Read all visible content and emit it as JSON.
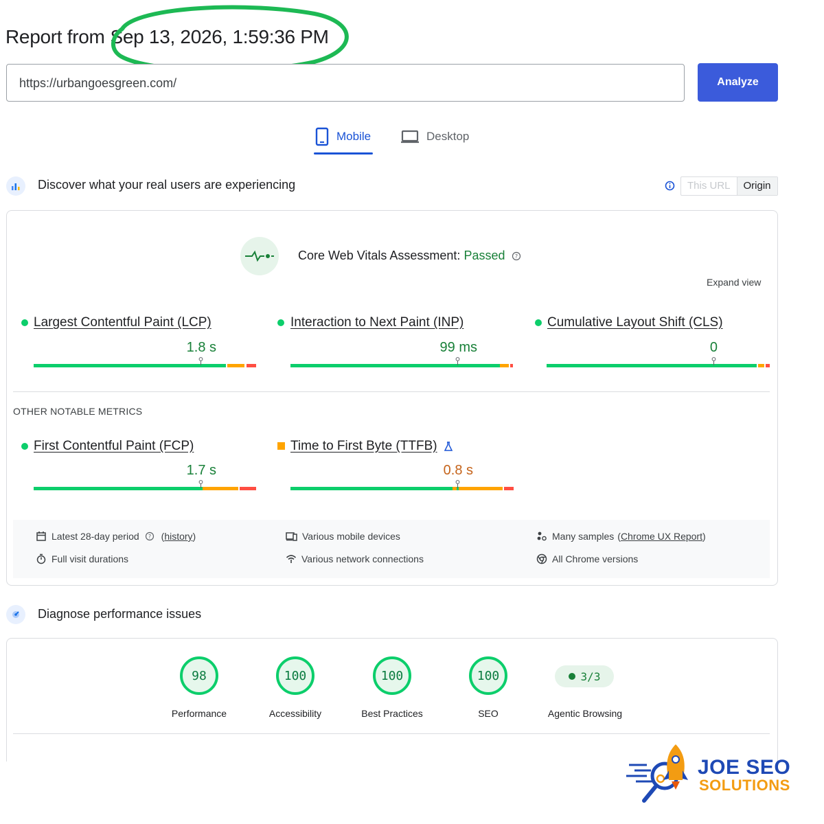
{
  "header": {
    "report_prefix": "Report from",
    "report_date": "Sep 13, 2026, 1:59:36 PM"
  },
  "url_input": {
    "value": "https://urbangoesgreen.com/"
  },
  "analyze_button": {
    "label": "Analyze",
    "color": "#3b5bdb"
  },
  "tabs": [
    {
      "label": "Mobile",
      "active": true
    },
    {
      "label": "Desktop",
      "active": false
    }
  ],
  "field_section": {
    "heading": "Discover what your real users are experiencing",
    "toggle": {
      "url_label": "This URL",
      "origin_label": "Origin",
      "selected": "Origin"
    }
  },
  "cwv": {
    "assessment_label": "Core Web Vitals Assessment:",
    "assessment_status": "Passed",
    "expand_label": "Expand view",
    "metrics": [
      {
        "name": "Largest Contentful Paint (LCP)",
        "value": "1.8 s",
        "status": "good",
        "distribution": [
          0.86,
          0.08,
          0.06
        ],
        "percentile_position": 0.75
      },
      {
        "name": "Interaction to Next Paint (INP)",
        "value": "99 ms",
        "status": "good",
        "distribution": [
          0.94,
          0.04,
          0.02
        ],
        "percentile_position": 0.75
      },
      {
        "name": "Cumulative Layout Shift (CLS)",
        "value": "0",
        "status": "good",
        "distribution": [
          0.94,
          0.04,
          0.02
        ],
        "percentile_position": 0.75
      }
    ]
  },
  "other_metrics": {
    "title": "OTHER NOTABLE METRICS",
    "metrics": [
      {
        "name": "First Contentful Paint (FCP)",
        "value": "1.7 s",
        "status": "good",
        "distribution": [
          0.76,
          0.16,
          0.08
        ],
        "percentile_position": 0.75
      },
      {
        "name": "Time to First Byte (TTFB)",
        "value": "0.8 s",
        "status": "needs-improvement",
        "distribution": [
          0.73,
          0.22,
          0.05
        ],
        "percentile_position": 0.75
      }
    ]
  },
  "footer_info": {
    "period": "Latest 28-day period",
    "history_link": "history",
    "devices": "Various mobile devices",
    "samples_prefix": "Many samples",
    "samples_link": "Chrome UX Report",
    "durations": "Full visit durations",
    "network": "Various network connections",
    "versions": "All Chrome versions"
  },
  "diagnose": {
    "heading": "Diagnose performance issues",
    "scores": [
      {
        "label": "Performance",
        "score": "98"
      },
      {
        "label": "Accessibility",
        "score": "100"
      },
      {
        "label": "Best Practices",
        "score": "100"
      },
      {
        "label": "SEO",
        "score": "100"
      }
    ],
    "agentic": {
      "label": "Agentic Browsing",
      "value": "3/3"
    }
  },
  "brand": {
    "line1": "JOE SEO",
    "line2": "SOLUTIONS"
  },
  "colors": {
    "good": "#0cce6b",
    "needs_improvement": "#ffa400",
    "poor": "#ff4e42",
    "highlight_ring": "#1db954"
  }
}
